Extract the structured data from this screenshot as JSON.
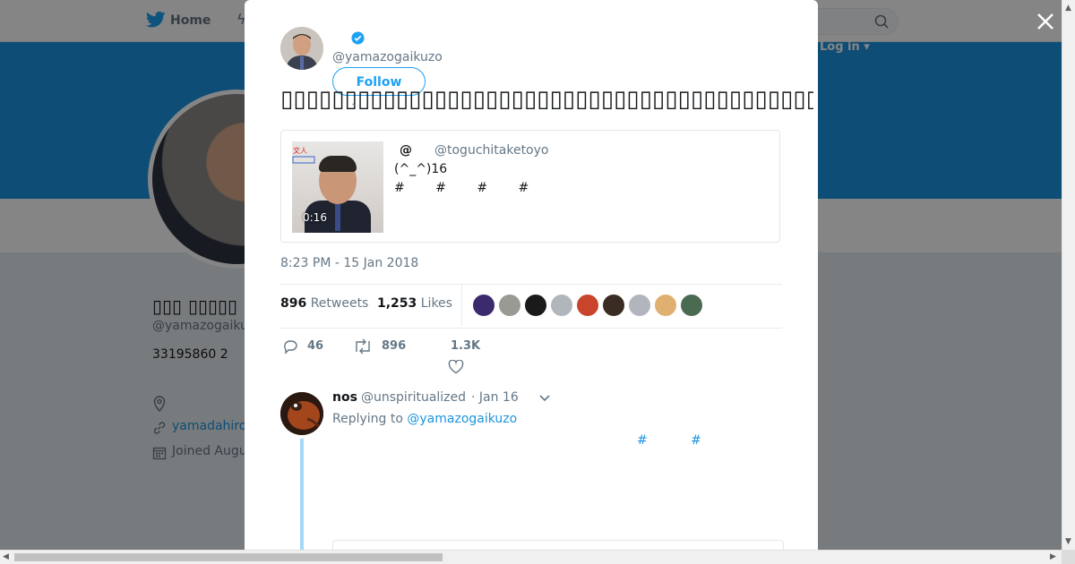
{
  "background": {
    "nav": {
      "home_label": "Home",
      "login_label": "Log in ▾"
    },
    "profile": {
      "name": "▯▯▯ ▯▯▯▯▯",
      "handle": "@yamazogaiku",
      "bio": "33195860 2",
      "link": "yamadahiro",
      "joined": "Joined Augu"
    }
  },
  "modal": {
    "author": {
      "handle": "@yamazogaikuzo",
      "follow_label": "Follow"
    },
    "tweet_text": "▯▯▯▯▯▯▯▯▯▯▯▯▯▯▯▯▯▯▯▯▯▯▯▯▯▯▯▯▯▯▯▯▯▯▯▯▯▯▯▯▯▯▯▯▯▯▯▯▯▯▯▯▯▯▯▯▯▯▯▯",
    "quote": {
      "name": "@",
      "handle": "@toguchitaketoyo",
      "line1": "(^_^)16",
      "line2": "# # # #",
      "video_duration": "0:16"
    },
    "timestamp": "8:23 PM - 15 Jan 2018",
    "stats": {
      "retweets_count": "896",
      "retweets_label": "Retweets",
      "likes_count": "1,253",
      "likes_label": "Likes"
    },
    "likers_colors": [
      "#3b2a6e",
      "#9a9a94",
      "#1a1a1a",
      "#b0b6bc",
      "#c8442a",
      "#3a2c22",
      "#b0b6bc",
      "#e0b070",
      "#4a6a52"
    ],
    "actions": {
      "replies": "46",
      "retweets": "896",
      "likes": "1.3K"
    },
    "reply": {
      "name": "nos",
      "handle": "@unspiritualized",
      "date": "· Jan 16",
      "replying_prefix": "Replying to",
      "replying_handle": "@yamazogaikuzo",
      "tags": "# #"
    }
  },
  "colors": {
    "accent": "#1da1f2",
    "banner": "#1b95e0",
    "overlay": "rgba(0,0,0,0.48)"
  }
}
